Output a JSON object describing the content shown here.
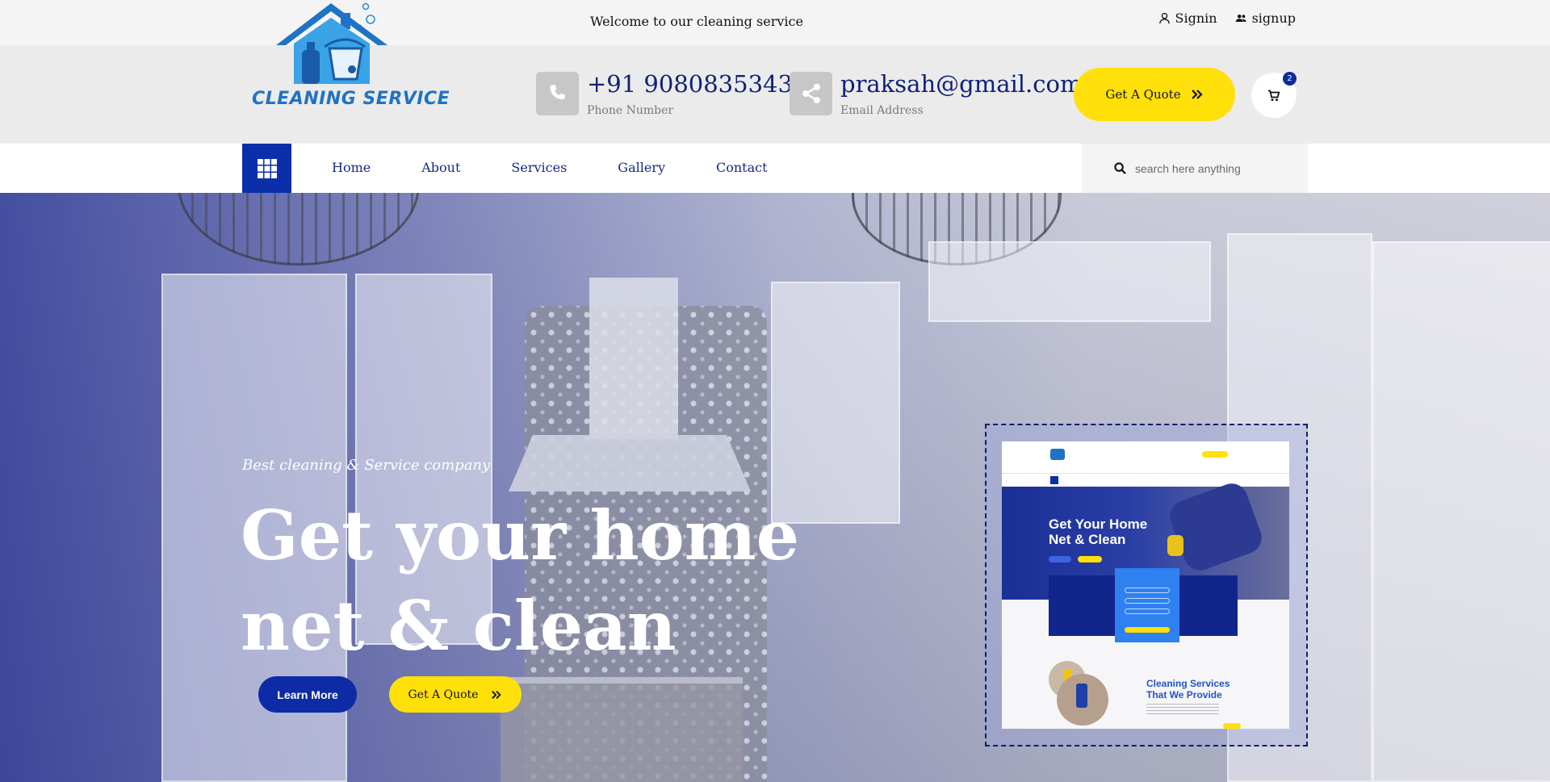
{
  "topbar": {
    "welcome": "Welcome to our cleaning service",
    "signin_label": "Signin",
    "signup_label": "signup"
  },
  "header": {
    "logo_text": "CLEANING SERVICE",
    "phone": {
      "value": "+91 9080835343",
      "label": "Phone Number"
    },
    "email": {
      "value": "praksah@gmail.com",
      "label": "Email Address"
    },
    "quote_label": "Get A Quote",
    "cart_count": "2"
  },
  "nav": {
    "items": [
      "Home",
      "About",
      "Services",
      "Gallery",
      "Contact"
    ],
    "search_placeholder": "search here anything"
  },
  "hero": {
    "tagline": "Best cleaning & Service company",
    "title_line1": "Get your home",
    "title_line2": "net & clean",
    "learn_more_label": "Learn More",
    "quote_label": "Get A Quote"
  },
  "preview": {
    "title_line1": "Get Your Home",
    "title_line2": "Net & Clean",
    "services_line1": "Cleaning Services",
    "services_line2": "That We Provide"
  },
  "colors": {
    "brand_blue": "#0a2fa8",
    "navy_text": "#10217a",
    "accent_yellow": "#ffe008"
  }
}
